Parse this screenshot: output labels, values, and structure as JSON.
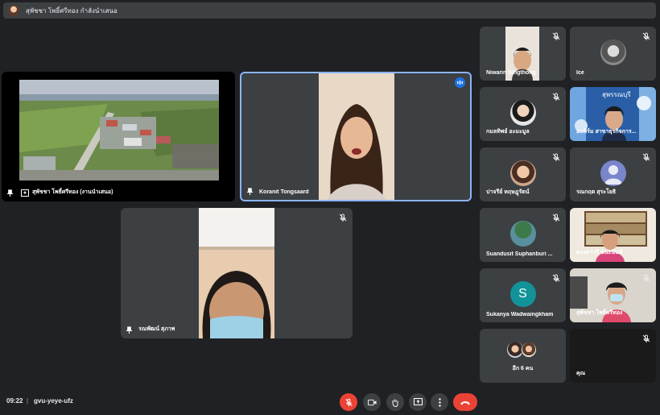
{
  "banner": {
    "text": "สุพัชชา โพธิ์ศรีทอง กำลังนำเสนอ"
  },
  "main_tiles": {
    "presentation": {
      "name": "สุพัชชา โพธิ์ศรีทอง (งานนำเสนอ)"
    },
    "speaker": {
      "name": "Koranit Tongsaard"
    },
    "third": {
      "name": "รณพัฒน์ สุภาพ"
    }
  },
  "sidebar": [
    {
      "name": "Niwarin Singthong"
    },
    {
      "name": "Ice"
    },
    {
      "name": "กมลทิพย์ อะมะมูล"
    },
    {
      "name": "อ.เพิร์ม สาขาธุรกิจการ..."
    },
    {
      "name": "ปาจรีย์ หฤษฎุรัตน์"
    },
    {
      "name": "รณกฤต สุระโยธิ",
      "initial": ""
    },
    {
      "name": "Suandusit Suphanburi ..."
    },
    {
      "name": "ดวงดาวรี ชนะนันท์"
    },
    {
      "name": "Sukanya Wadwaingkham",
      "initial": "S"
    },
    {
      "name": "สุพัชชา โพธิ์ศรีทอง"
    },
    {
      "name": "อีก 6 คน"
    },
    {
      "name": "คุณ"
    }
  ],
  "bottom": {
    "time": "09:22",
    "separator": "|",
    "meeting_code": "gvu-yeye-ufz"
  },
  "colors": {
    "background": "#202124",
    "tile": "#3c4043",
    "accent": "#8ab4f8",
    "danger": "#ea4335"
  }
}
